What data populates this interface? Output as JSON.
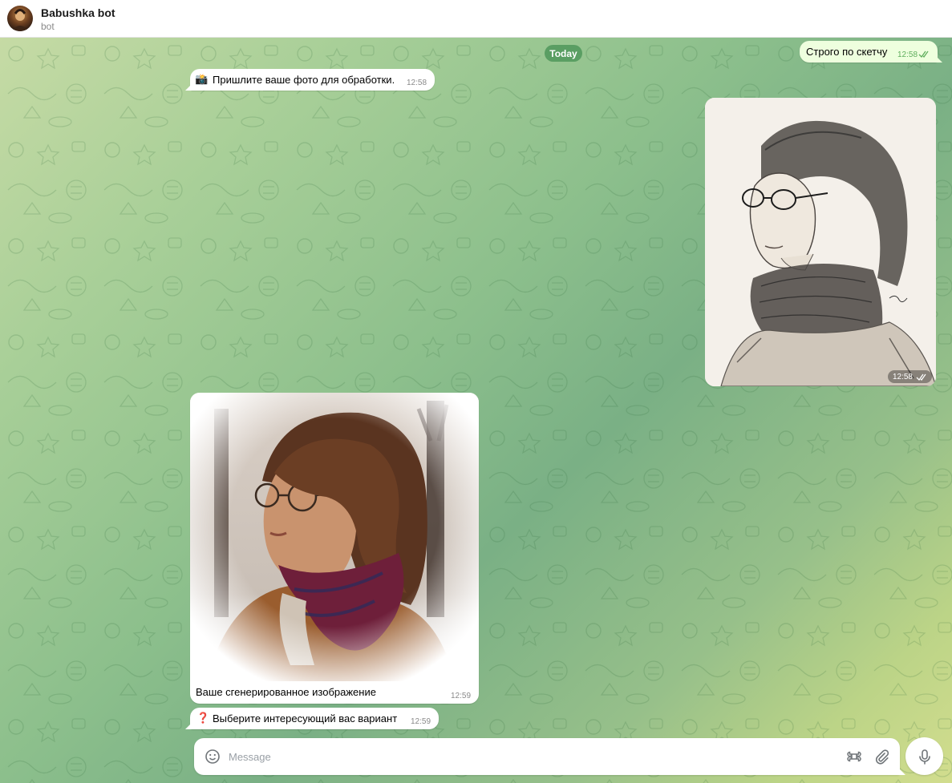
{
  "header": {
    "title": "Babushka bot",
    "subtitle": "bot",
    "avatar_icon": "bot-avatar"
  },
  "chat": {
    "date_separator": "Today",
    "messages": [
      {
        "id": "m1",
        "direction": "out",
        "text": "Строго по скетчу",
        "time": "12:58",
        "status": "read"
      },
      {
        "id": "m2",
        "direction": "in",
        "emoji": "📸",
        "text": "Пришлите ваше фото для обработки.",
        "time": "12:58"
      },
      {
        "id": "m3",
        "direction": "out",
        "type": "photo",
        "description": "pencil-sketch-portrait",
        "time": "12:58",
        "status": "read"
      },
      {
        "id": "m4",
        "direction": "in",
        "type": "photo",
        "caption": "Ваше сгенерированное изображение",
        "time": "12:59"
      },
      {
        "id": "m5",
        "direction": "in",
        "emoji": "❓",
        "text": "Выберите интересующий вас вариант",
        "time": "12:59"
      }
    ]
  },
  "composer": {
    "placeholder": "Message",
    "value": "",
    "icons": [
      "emoji-icon",
      "bot-command-icon",
      "attach-icon",
      "microphone-icon"
    ]
  },
  "colors": {
    "outgoing_bubble": "#eeffde",
    "incoming_bubble": "#ffffff",
    "date_badge": "#5a9e63",
    "read_check": "#5fae5d"
  }
}
